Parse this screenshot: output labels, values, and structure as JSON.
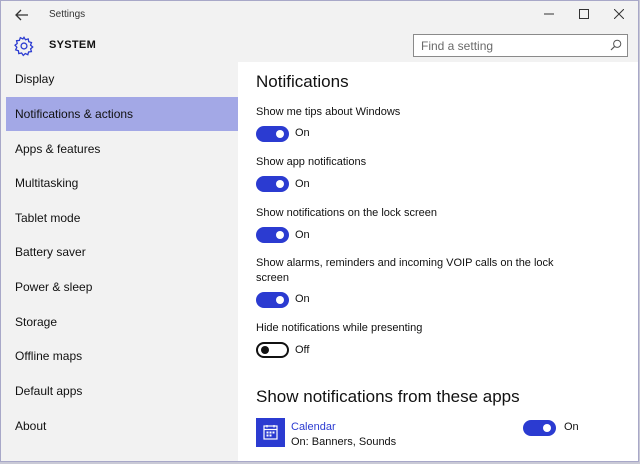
{
  "window": {
    "title": "Settings"
  },
  "header": {
    "section_title": "SYSTEM",
    "search_placeholder": "Find a setting"
  },
  "sidebar": {
    "items": [
      {
        "label": "Display",
        "active": false
      },
      {
        "label": "Notifications & actions",
        "active": true
      },
      {
        "label": "Apps & features",
        "active": false
      },
      {
        "label": "Multitasking",
        "active": false
      },
      {
        "label": "Tablet mode",
        "active": false
      },
      {
        "label": "Battery saver",
        "active": false
      },
      {
        "label": "Power & sleep",
        "active": false
      },
      {
        "label": "Storage",
        "active": false
      },
      {
        "label": "Offline maps",
        "active": false
      },
      {
        "label": "Default apps",
        "active": false
      },
      {
        "label": "About",
        "active": false
      }
    ]
  },
  "main": {
    "heading": "Notifications",
    "settings": [
      {
        "label": "Show me tips about Windows",
        "state": "On",
        "on": true
      },
      {
        "label": "Show app notifications",
        "state": "On",
        "on": true
      },
      {
        "label": "Show notifications on the lock screen",
        "state": "On",
        "on": true
      },
      {
        "label": "Show alarms, reminders and incoming VOIP calls on the lock screen",
        "state": "On",
        "on": true
      },
      {
        "label": "Hide notifications while presenting",
        "state": "Off",
        "on": false
      }
    ],
    "apps_heading": "Show notifications from these apps",
    "apps": [
      {
        "name": "Calendar",
        "detail": "On: Banners, Sounds",
        "state": "On",
        "on": true
      }
    ]
  },
  "colors": {
    "accent": "#2b3bd1",
    "sidebar_active": "#a3a8e6"
  }
}
